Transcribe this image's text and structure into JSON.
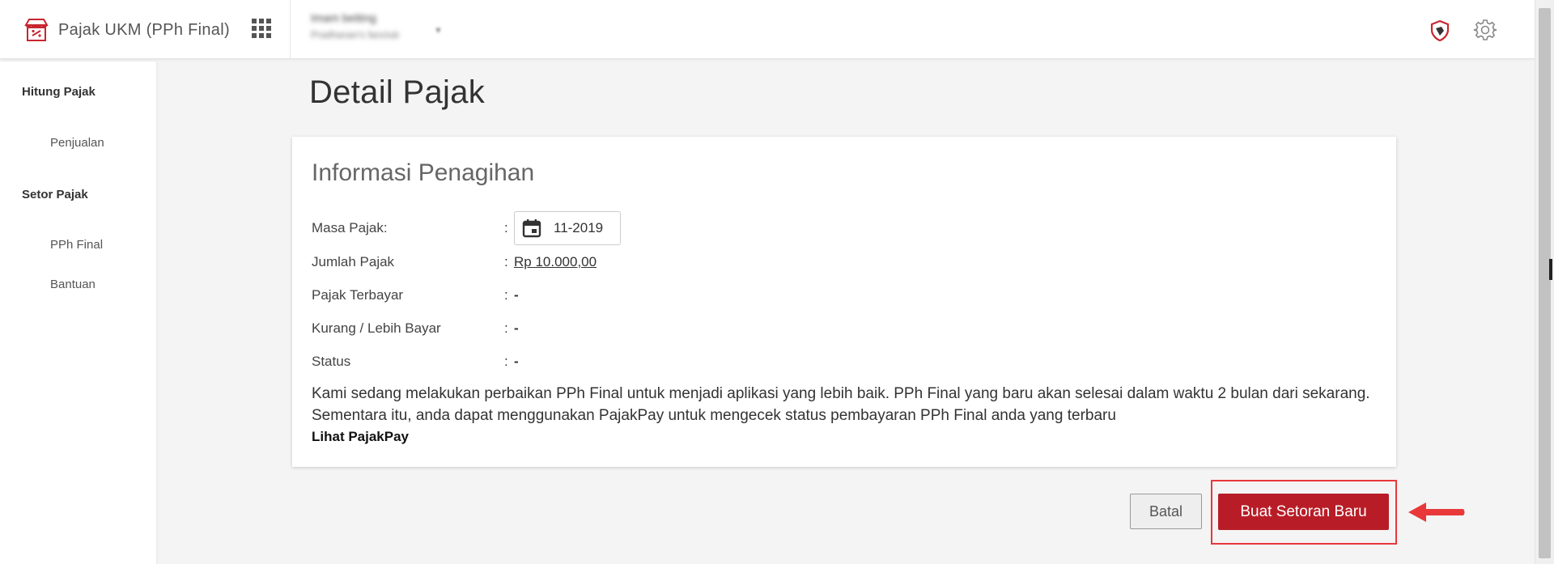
{
  "header": {
    "app_title": "Pajak UKM (PPh Final)",
    "user_name": "Imam betting",
    "user_subtitle": "Pradhanan's fanclub"
  },
  "icons": {
    "logo": "storefront-icon",
    "apps": "apps-grid-icon",
    "security": "shield-icon",
    "settings": "gear-icon",
    "calendar": "calendar-icon"
  },
  "sidebar": {
    "sections": [
      {
        "heading": "Hitung Pajak",
        "items": [
          "Penjualan"
        ]
      },
      {
        "heading": "Setor Pajak",
        "items": [
          "PPh Final",
          "Bantuan"
        ]
      }
    ]
  },
  "main": {
    "page_title": "Detail Pajak",
    "card": {
      "title": "Informasi Penagihan",
      "rows": [
        {
          "label": "Masa Pajak:",
          "value": "11-2019"
        },
        {
          "label": "Jumlah Pajak",
          "value": "Rp 10.000,00"
        },
        {
          "label": "Pajak Terbayar",
          "value": "-"
        },
        {
          "label": "Kurang / Lebih Bayar",
          "value": "-"
        },
        {
          "label": "Status",
          "value": "-"
        }
      ],
      "notice": "Kami sedang melakukan perbaikan PPh Final untuk menjadi aplikasi yang lebih baik. PPh Final yang baru akan selesai dalam waktu 2 bulan dari sekarang. Sementara itu, anda dapat menggunakan PajakPay untuk mengecek status pembayaran PPh Final anda yang terbaru",
      "link": "Lihat PajakPay"
    },
    "buttons": {
      "cancel": "Batal",
      "create": "Buat Setoran Baru"
    }
  },
  "colors": {
    "primary": "#b81d27",
    "highlight": "#e8383a",
    "brand_icon": "#c8262f"
  }
}
